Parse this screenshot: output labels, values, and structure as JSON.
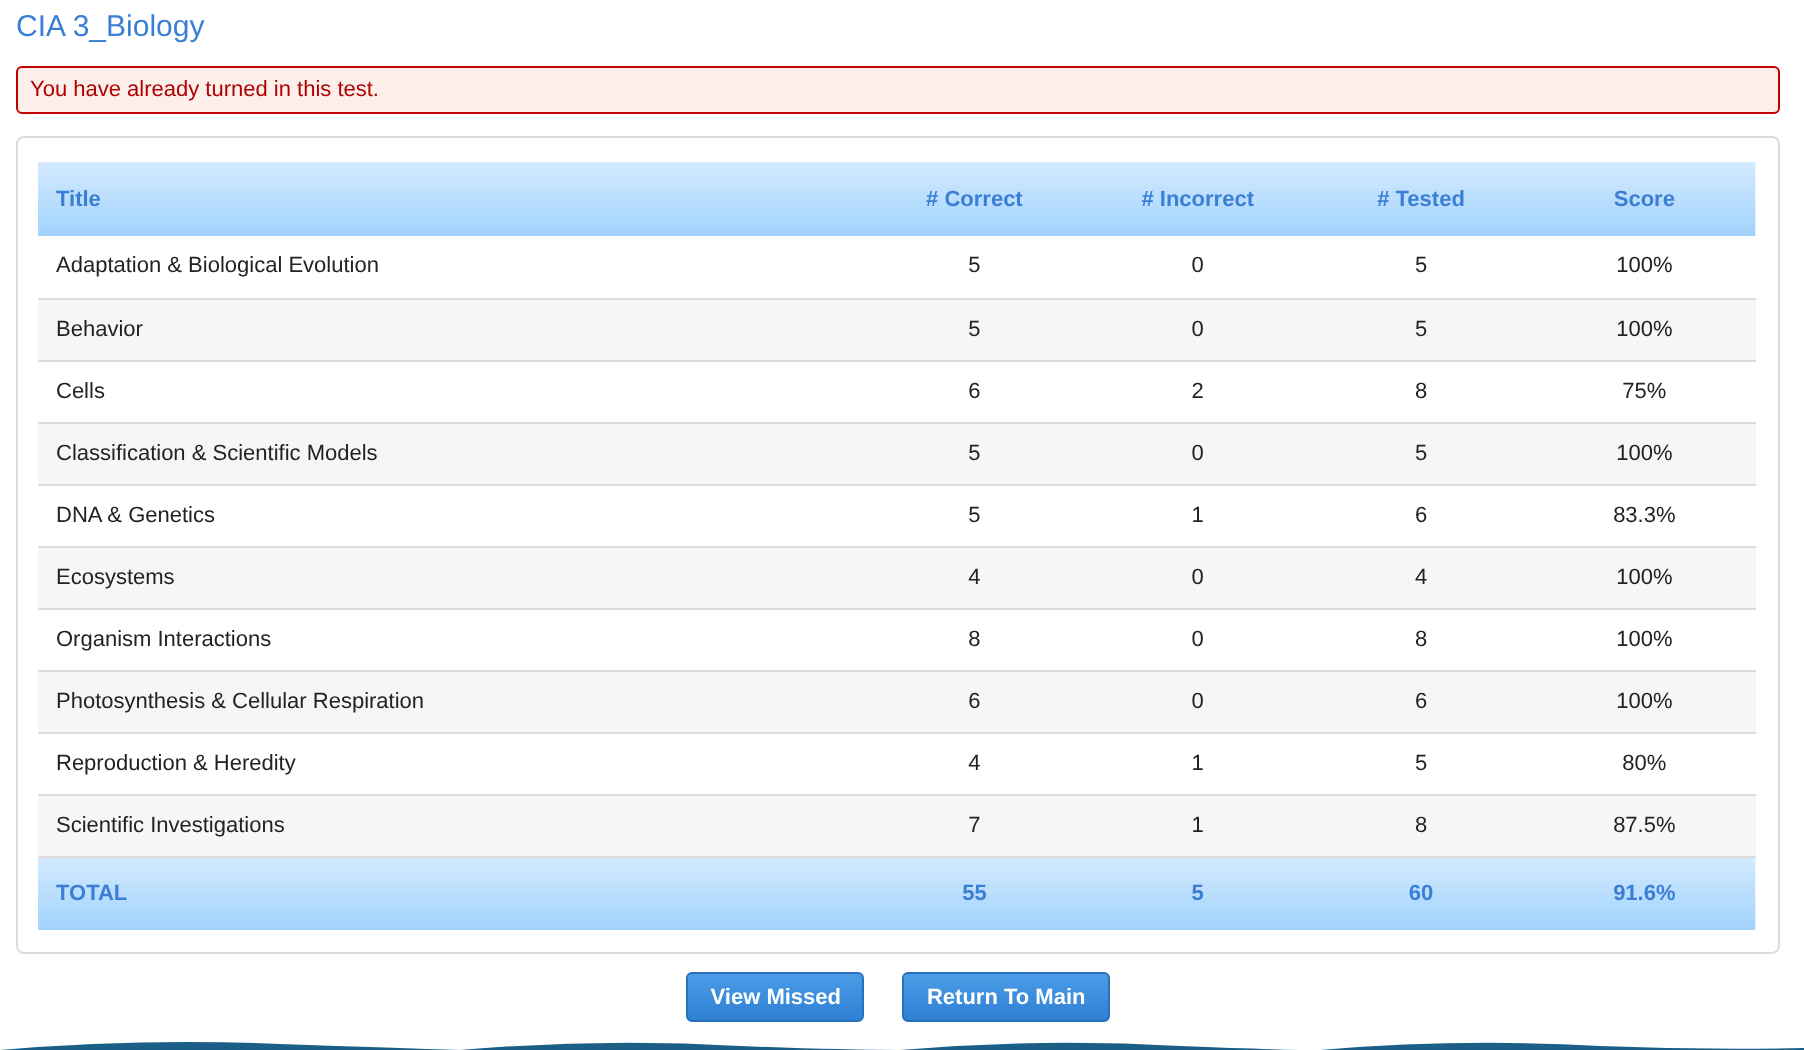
{
  "page_title": "CIA 3_Biology",
  "alert": "You have already turned in this test.",
  "table": {
    "columns": [
      "Title",
      "# Correct",
      "# Incorrect",
      "# Tested",
      "Score"
    ],
    "rows": [
      [
        "Adaptation & Biological Evolution",
        "5",
        "0",
        "5",
        "100%"
      ],
      [
        "Behavior",
        "5",
        "0",
        "5",
        "100%"
      ],
      [
        "Cells",
        "6",
        "2",
        "8",
        "75%"
      ],
      [
        "Classification & Scientific Models",
        "5",
        "0",
        "5",
        "100%"
      ],
      [
        "DNA & Genetics",
        "5",
        "1",
        "6",
        "83.3%"
      ],
      [
        "Ecosystems",
        "4",
        "0",
        "4",
        "100%"
      ],
      [
        "Organism Interactions",
        "8",
        "0",
        "8",
        "100%"
      ],
      [
        "Photosynthesis & Cellular Respiration",
        "6",
        "0",
        "6",
        "100%"
      ],
      [
        "Reproduction & Heredity",
        "4",
        "1",
        "5",
        "80%"
      ],
      [
        "Scientific Investigations",
        "7",
        "1",
        "8",
        "87.5%"
      ]
    ],
    "total": [
      "TOTAL",
      "55",
      "5",
      "60",
      "91.6%"
    ]
  },
  "buttons": [
    "View Missed",
    "Return To Main"
  ]
}
